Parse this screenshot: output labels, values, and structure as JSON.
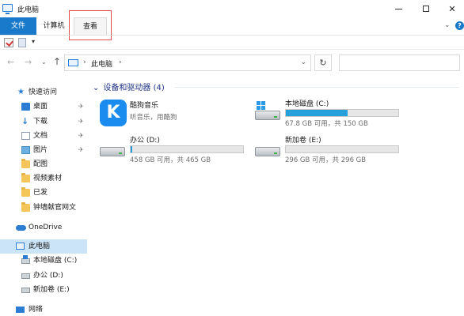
{
  "window": {
    "title": "此电脑",
    "controls": {
      "minimize": "—",
      "maximize": "☐",
      "close": "✕"
    }
  },
  "ribbon": {
    "tabs": [
      {
        "label": "文件",
        "active": true
      },
      {
        "label": "计算机",
        "active": false
      },
      {
        "label": "查看",
        "active": false
      }
    ],
    "collapse_chevron": "⌄",
    "help": "?"
  },
  "quick_access_toolbar": {
    "icons": [
      "properties-check-icon",
      "new-document-icon",
      "customize-dropdown-icon"
    ],
    "dropdown": "▾"
  },
  "navigation": {
    "back": "←",
    "forward": "→",
    "recent": "⌄",
    "up": "↑",
    "breadcrumb": [
      "此电脑"
    ],
    "separator": "›",
    "address_dropdown": "⌄",
    "refresh": "↻",
    "search_placeholder": ""
  },
  "sidebar": {
    "quick_access": {
      "label": "快速访问",
      "items": [
        {
          "label": "桌面",
          "icon": "desktop-icon",
          "pinned": true
        },
        {
          "label": "下载",
          "icon": "download-icon",
          "pinned": true
        },
        {
          "label": "文档",
          "icon": "documents-icon",
          "pinned": true
        },
        {
          "label": "图片",
          "icon": "pictures-icon",
          "pinned": true
        },
        {
          "label": "配图",
          "icon": "folder-icon",
          "pinned": false
        },
        {
          "label": "视频素材",
          "icon": "folder-icon",
          "pinned": false
        },
        {
          "label": "已发",
          "icon": "folder-icon",
          "pinned": false
        },
        {
          "label": "钟墙献官网文",
          "icon": "folder-icon",
          "pinned": false
        }
      ]
    },
    "onedrive": {
      "label": "OneDrive"
    },
    "this_pc": {
      "label": "此电脑",
      "selected": true,
      "drives": [
        {
          "label": "本地磁盘 (C:)"
        },
        {
          "label": "办公 (D:)"
        },
        {
          "label": "新加卷 (E:)"
        }
      ]
    },
    "network": {
      "label": "网络"
    },
    "pin_glyph": "📌"
  },
  "content": {
    "group_title": "设备和驱动器 (4)",
    "group_chevron": "⌄",
    "devices": [
      {
        "name": "酷狗音乐",
        "subtitle": "听音乐，用酷狗",
        "icon": "kugou-music-icon",
        "icon_letter": "K"
      },
      {
        "name": "本地磁盘 (C:)",
        "subtitle": "67.8 GB 可用，共 150 GB",
        "used_fraction": 0.55,
        "icon": "system-drive-icon"
      },
      {
        "name": "办公 (D:)",
        "subtitle": "458 GB 可用，共 465 GB",
        "used_fraction": 0.015,
        "icon": "drive-icon"
      },
      {
        "name": "新加卷 (E:)",
        "subtitle": "296 GB 可用，共 296 GB",
        "used_fraction": 0.0,
        "icon": "drive-icon"
      }
    ]
  },
  "colors": {
    "accent": "#1979ca",
    "selected_bg": "#cce4f7",
    "usage_bar": "#26a0da",
    "group_header": "#1e3287",
    "annotation_box": "#e54b4b"
  }
}
